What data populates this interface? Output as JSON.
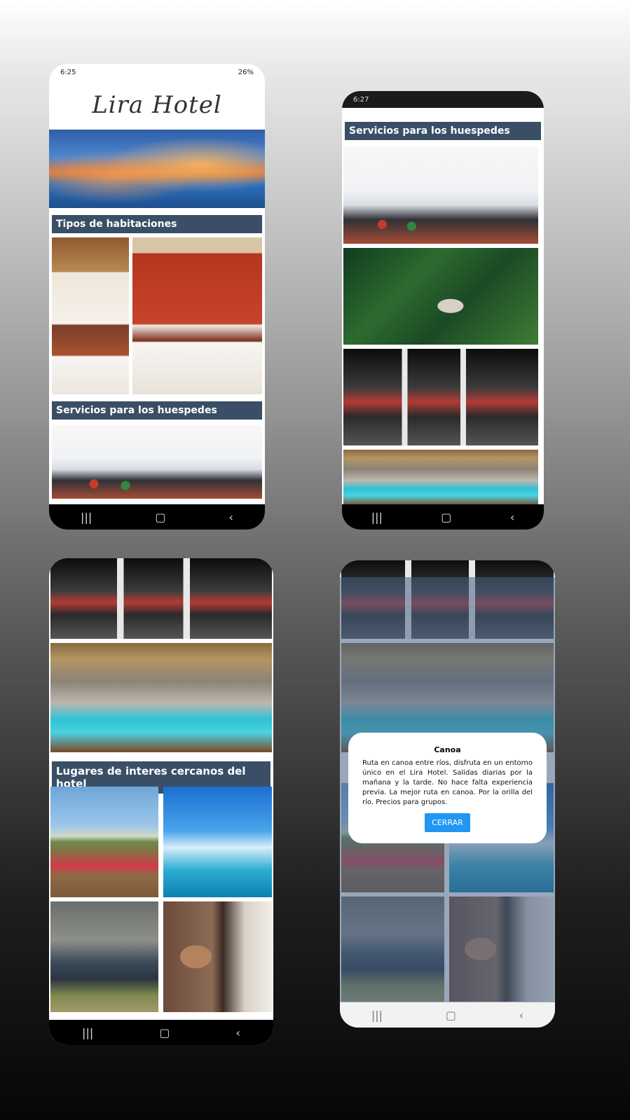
{
  "screen1": {
    "status_time": "6:25",
    "status_battery": "26%",
    "brand": "Lira Hotel",
    "section_rooms": "Tipos de habitaciones",
    "section_services": "Servicios para los huespedes"
  },
  "screen2": {
    "status_time": "6:27",
    "section_services": "Servicios para los huespedes"
  },
  "screen3": {
    "section_places": "Lugares de interes cercanos del hotel"
  },
  "screen4": {
    "dialog": {
      "title": "Canoa",
      "body": "Ruta en canoa entre ríos, disfruta en un entorno único en el Lira Hotel. Salidas diarias por la mañana y la tarde. No hace falta experiencia previa. La mejor ruta en canoa. Por la orilla del río. Precios para grupos.",
      "button": "CERRAR"
    }
  },
  "nav_icons": [
    "recent-apps-icon",
    "home-icon",
    "back-icon"
  ]
}
